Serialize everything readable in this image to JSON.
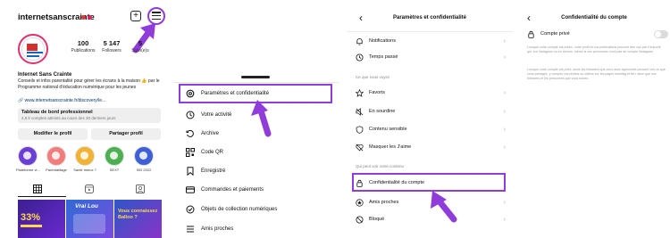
{
  "profile": {
    "username": "internetsanscrainte",
    "stats": [
      {
        "num": "100",
        "label": "Publications"
      },
      {
        "num": "5 147",
        "label": "Followers"
      },
      {
        "num": "5",
        "label": "Suivi(e)s"
      }
    ],
    "name": "Internet Sans Crainte",
    "bio": "Conseils et infos parentalité pour gérer les écrans à la maison 👍 par le Programme national d'éducation numérique pour les jeunes",
    "link": "www.internetsanscrainte.fr/discovery/le...",
    "dashboard_title": "Tableau de bord professionnel",
    "dashboard_sub": "4,5 k comptes atteints au cours des 30 derniers jours",
    "edit_button": "Modifier le profil",
    "share_button": "Partager profil",
    "highlights": [
      {
        "label": "Plateforme vi...",
        "color": "#6b3fd6"
      },
      {
        "label": "Parentalitage",
        "color": "#f27d7d"
      },
      {
        "label": "Santé mieux ?",
        "color": "#f2b233"
      },
      {
        "label": "SEXT",
        "color": "#4caf50"
      },
      {
        "label": "SID 2022",
        "color": "#3f5fd6"
      }
    ],
    "posts": [
      {
        "text": "33%"
      },
      {
        "text": "Vrai Lou"
      },
      {
        "text": "Vous connaissez Balloo ?"
      }
    ]
  },
  "menu": {
    "items": [
      {
        "label": "Paramètres et confidentialité",
        "icon": "settings-icon"
      },
      {
        "label": "Votre activité",
        "icon": "activity-icon"
      },
      {
        "label": "Archive",
        "icon": "archive-icon"
      },
      {
        "label": "Code QR",
        "icon": "qr-code-icon"
      },
      {
        "label": "Enregistré",
        "icon": "bookmark-icon"
      },
      {
        "label": "Commandes et paiements",
        "icon": "card-icon"
      },
      {
        "label": "Objets de collection numériques",
        "icon": "collectibles-icon"
      },
      {
        "label": "Amis proches",
        "icon": "close-friends-icon"
      }
    ]
  },
  "settings": {
    "title": "Paramètres et confidentialité",
    "section_top": [
      {
        "label": "Notifications",
        "icon": "bell-icon"
      },
      {
        "label": "Temps passé",
        "icon": "clock-icon"
      }
    ],
    "section1_title": "Ce que vous voyez",
    "section1": [
      {
        "label": "Favoris",
        "icon": "star-icon"
      },
      {
        "label": "En sourdine",
        "icon": "mute-icon"
      },
      {
        "label": "Contenu sensible",
        "icon": "sensitive-icon"
      },
      {
        "label": "Masquer les J'aime",
        "icon": "heart-off-icon"
      }
    ],
    "section2_title": "Qui peut voir votre contenu",
    "section2": [
      {
        "label": "Confidentialité du compte",
        "icon": "lock-icon"
      },
      {
        "label": "Amis proches",
        "icon": "star-circle-icon"
      },
      {
        "label": "Bloqué",
        "icon": "block-icon"
      }
    ]
  },
  "privacy": {
    "title": "Confidentialité du compte",
    "private_label": "Compte privé",
    "private_enabled": false,
    "paragraph1": "Lorsque votre compte est public, votre profil et vos publications peuvent être vus par n'importe qui, sur Instagram ou en dehors, même si ces personnes n'ont pas de compte Instagram.",
    "paragraph2": "Lorsque votre compte est privé, seuls les followers que vous avez approuvés peuvent voir ce que vous partagez, y compris vos photos ou vidéos sur les pages hashtag et lieu, ainsi que vos followers et les personnes que vous suivez."
  },
  "colors": {
    "highlight": "#8f3cdb",
    "instagram_ring": "#e1306c"
  }
}
